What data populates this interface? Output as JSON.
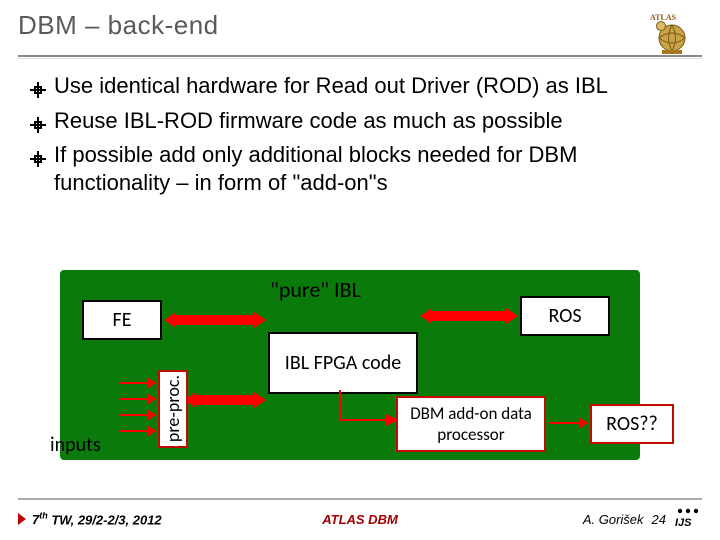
{
  "header": {
    "title": "DBM – back-end"
  },
  "bullets": {
    "b1": "Use identical hardware for Read out Driver (ROD) as IBL",
    "b2": "Reuse IBL-ROD firmware code as much as possible",
    "b3": "If possible add only additional blocks needed for DBM functionality – in form of \"add-on\"s"
  },
  "diagram": {
    "fe": "FE",
    "ros1": "ROS",
    "pure_ibl": "\"pure\" IBL",
    "ibl_fpga": "IBL FPGA code",
    "inputs": "inputs",
    "preproc": "pre-proc.",
    "dbm_proc": "DBM add-on data processor",
    "ros2": "ROS??"
  },
  "footer": {
    "left_sup": "7th",
    "left_rest": " TW, 29/2-2/3, 2012",
    "center": "ATLAS DBM",
    "author": "A. Gorišek",
    "page": "24"
  }
}
